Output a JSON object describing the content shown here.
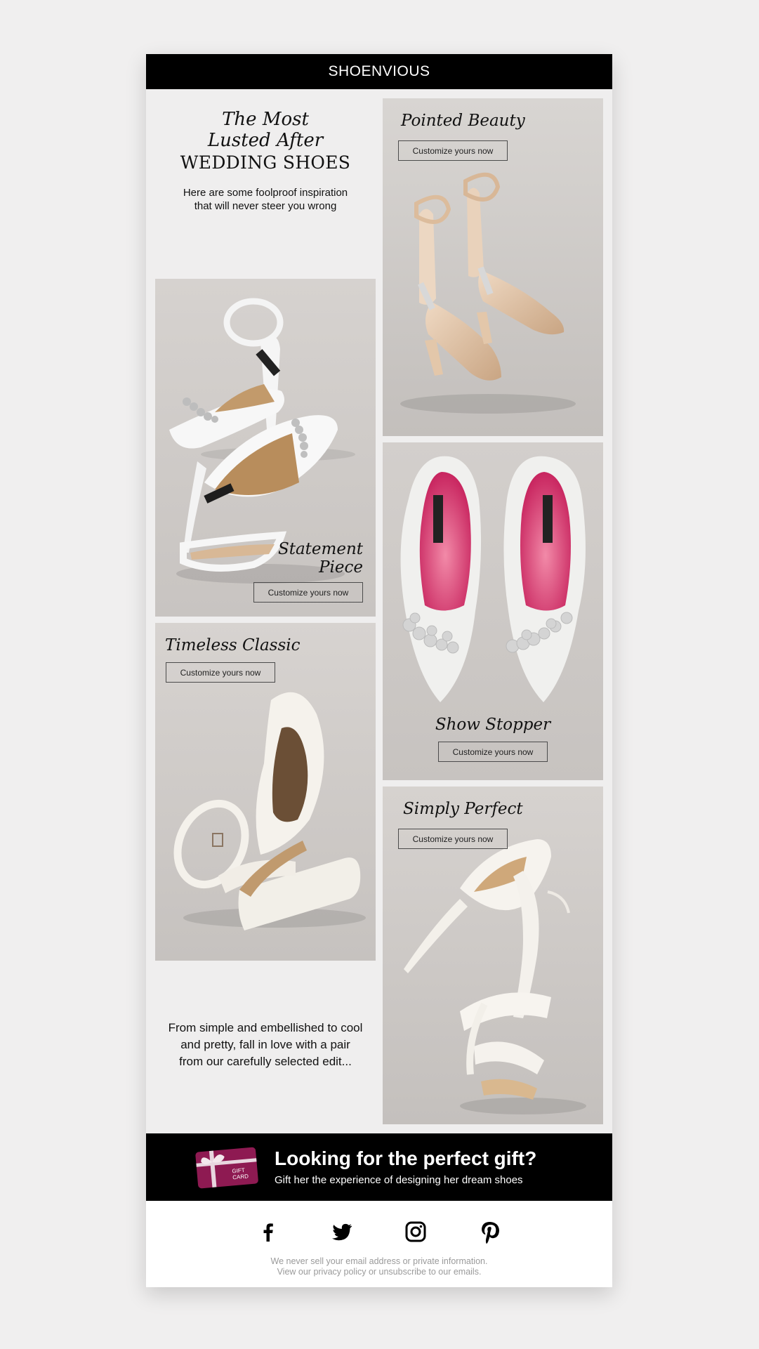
{
  "brand": {
    "logo": "SHOENVIOUS"
  },
  "intro": {
    "headline_line1": "The Most",
    "headline_line2": "Lusted After",
    "headline_line3": "WEDDING SHOES",
    "subtitle_line1": "Here are some foolproof inspiration",
    "subtitle_line2": "that will never steer you wrong"
  },
  "products": {
    "pointed_beauty": {
      "title": "Pointed Beauty",
      "button": "Customize yours now"
    },
    "statement_piece": {
      "title_line1": "Statement",
      "title_line2": "Piece",
      "button": "Customize yours now"
    },
    "show_stopper": {
      "title": "Show Stopper",
      "button": "Customize yours now"
    },
    "timeless_classic": {
      "title": "Timeless Classic",
      "button": "Customize yours now"
    },
    "simply_perfect": {
      "title": "Simply Perfect",
      "button": "Customize yours now"
    }
  },
  "outro": {
    "line1": "From simple and embellished to cool",
    "line2": "and pretty, fall in love with a pair",
    "line3": "from our carefully selected edit..."
  },
  "gift": {
    "card_line1": "GIFT",
    "card_line2": "CARD",
    "headline": "Looking for the perfect gift?",
    "subtext": "Gift her the experience of designing her dream shoes"
  },
  "social_icons": [
    "facebook-icon",
    "twitter-icon",
    "instagram-icon",
    "pinterest-icon"
  ],
  "disclaimer": {
    "line1": "We never sell your email address or private information.",
    "line2": "View our privacy policy or unsubscribe to our emails."
  },
  "colors": {
    "bar": "#000000",
    "panel_bg": "#cdc9c6",
    "email_bg": "#efeeee",
    "insole_pink": "#d4306b",
    "gift_card": "#8e1a52"
  }
}
